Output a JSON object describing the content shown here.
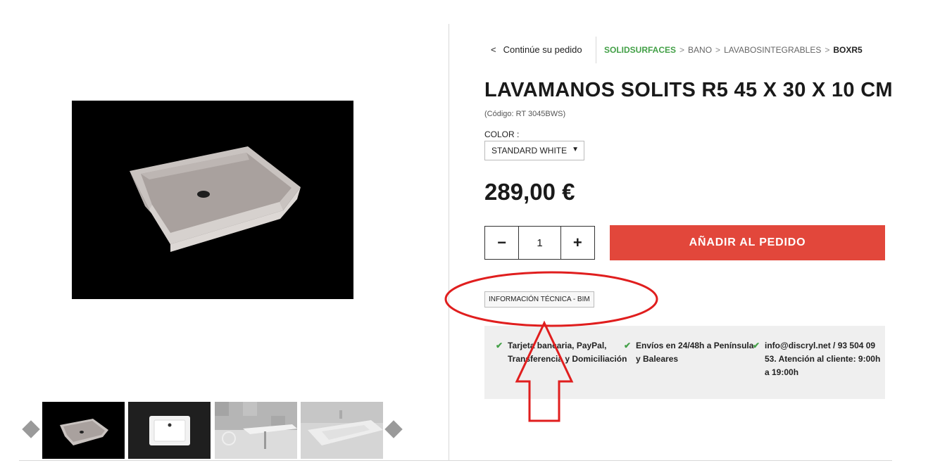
{
  "breadcrumb": {
    "back_label": "Continúe su pedido",
    "back_icon": "<",
    "items": [
      "SOLIDSURFACES",
      "BANO",
      "LAVABOSINTEGRABLES",
      "BOXR5"
    ],
    "separator": ">"
  },
  "product": {
    "title": "LAVAMANOS SOLITS R5 45 X 30 X 10 CM",
    "code": "(Código: RT 3045BWS)",
    "color_label": "COLOR :",
    "color_value": "STANDARD WHITE",
    "price": "289,00 €"
  },
  "cart": {
    "minus": "−",
    "quantity": "1",
    "plus": "+",
    "add_label": "AÑADIR AL PEDIDO"
  },
  "tech_info_label": "INFORMACIÓN TÉCNICA - BIM",
  "info": [
    {
      "lines": [
        "Tarjeta bancaria, PayPal,",
        "Transferencia y Domiciliación"
      ]
    },
    {
      "lines": [
        "Envíos en 24/48h a Península",
        "y Baleares"
      ]
    },
    {
      "lines": [
        "info@discryl.net / 93 504 09",
        "53. Atención al cliente: 9:00h",
        "a 19:00h"
      ]
    }
  ],
  "colors": {
    "accent_green": "#43a047",
    "add_button": "#e2473b",
    "annotation_red": "#e01e1e"
  }
}
